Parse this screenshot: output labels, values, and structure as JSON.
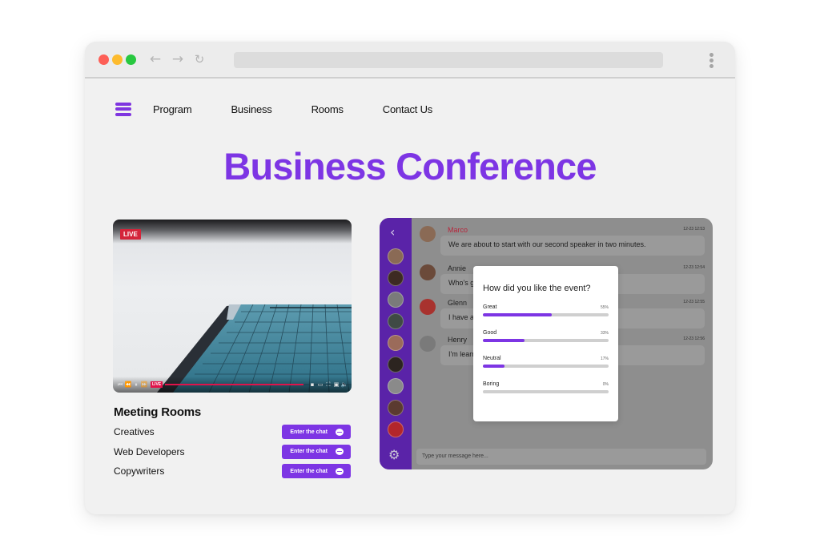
{
  "browser": {
    "back_icon": "←",
    "forward_icon": "→",
    "reload_icon": "↻"
  },
  "nav": {
    "items": [
      "Program",
      "Business",
      "Rooms",
      "Contact Us"
    ]
  },
  "title": "Business Conference",
  "video": {
    "live_badge": "LIVE",
    "controls_live": "LIVE",
    "icons": [
      "skip-back",
      "rewind",
      "pause",
      "fast-forward",
      "chat",
      "captions",
      "fullscreen",
      "pip",
      "volume"
    ]
  },
  "rooms": {
    "heading": "Meeting Rooms",
    "items": [
      {
        "name": "Creatives",
        "button": "Enter the chat"
      },
      {
        "name": "Web Developers",
        "button": "Enter the chat"
      },
      {
        "name": "Copywriters",
        "button": "Enter the chat"
      }
    ]
  },
  "chat": {
    "back_icon": "‹",
    "gear_icon": "⚙",
    "input_placeholder": "Type your message here...",
    "messages": [
      {
        "name": "Marco",
        "time": "12-23 12:53",
        "text": "We are about to start with our second speaker in two minutes."
      },
      {
        "name": "Annie",
        "time": "12-23 12:54",
        "text": "Who's g                                                    d!"
      },
      {
        "name": "Glenn",
        "time": "12-23 12:55",
        "text": "I have a"
      },
      {
        "name": "Henry",
        "time": "12-23 12:56",
        "text": "I'm learn"
      }
    ],
    "sidebar_avatar_colors": [
      "#8a6a55",
      "#3d2a22",
      "#7a7a7a",
      "#3f4a44",
      "#9b6b5a",
      "#2c2420",
      "#8a8a8a",
      "#5b3a30",
      "#b3262a"
    ]
  },
  "poll": {
    "question": "How did you like the event?",
    "options": [
      {
        "label": "Great",
        "pct_label": "55%",
        "value": 55
      },
      {
        "label": "Good",
        "pct_label": "33%",
        "value": 33
      },
      {
        "label": "Neutral",
        "pct_label": "17%",
        "value": 17
      },
      {
        "label": "Boring",
        "pct_label": "0%",
        "value": 0
      }
    ]
  },
  "colors": {
    "accent": "#7d35e4",
    "sidebar": "#5a23a8",
    "live": "#d4243a"
  }
}
